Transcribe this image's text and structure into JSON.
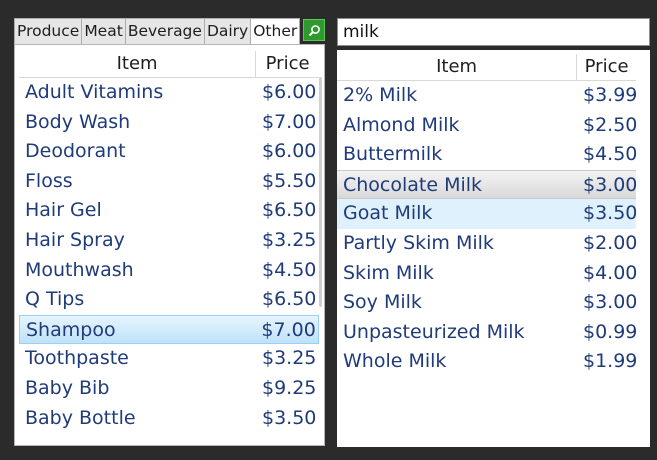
{
  "tabs": [
    {
      "label": "Produce"
    },
    {
      "label": "Meat"
    },
    {
      "label": "Beverage"
    },
    {
      "label": "Dairy"
    },
    {
      "label": "Other",
      "active": true
    }
  ],
  "search_button_icon": "search-icon",
  "left_grid": {
    "headers": {
      "item": "Item",
      "price": "Price"
    },
    "rows": [
      {
        "item": "Adult Vitamins",
        "price": "$6.00"
      },
      {
        "item": "Body Wash",
        "price": "$7.00"
      },
      {
        "item": "Deodorant",
        "price": "$6.00"
      },
      {
        "item": "Floss",
        "price": "$5.50"
      },
      {
        "item": "Hair Gel",
        "price": "$6.50"
      },
      {
        "item": "Hair Spray",
        "price": "$3.25"
      },
      {
        "item": "Mouthwash",
        "price": "$4.50"
      },
      {
        "item": "Q Tips",
        "price": "$6.50"
      },
      {
        "item": "Shampoo",
        "price": "$7.00"
      },
      {
        "item": "Toothpaste",
        "price": "$3.25"
      },
      {
        "item": "Baby Bib",
        "price": "$9.25"
      },
      {
        "item": "Baby Bottle",
        "price": "$3.50"
      }
    ]
  },
  "search_input": {
    "value": "milk"
  },
  "right_grid": {
    "headers": {
      "item": "Item",
      "price": "Price"
    },
    "rows": [
      {
        "item": "2% Milk",
        "price": "$3.99"
      },
      {
        "item": "Almond Milk",
        "price": "$2.50"
      },
      {
        "item": "Buttermilk",
        "price": "$4.50"
      },
      {
        "item": "Chocolate Milk",
        "price": "$3.00"
      },
      {
        "item": "Goat Milk",
        "price": "$3.50"
      },
      {
        "item": "Partly Skim Milk",
        "price": "$2.00"
      },
      {
        "item": "Skim Milk",
        "price": "$4.00"
      },
      {
        "item": "Soy Milk",
        "price": "$3.00"
      },
      {
        "item": "Unpasteurized Milk",
        "price": "$0.99"
      },
      {
        "item": "Whole Milk",
        "price": "$1.99"
      }
    ]
  }
}
